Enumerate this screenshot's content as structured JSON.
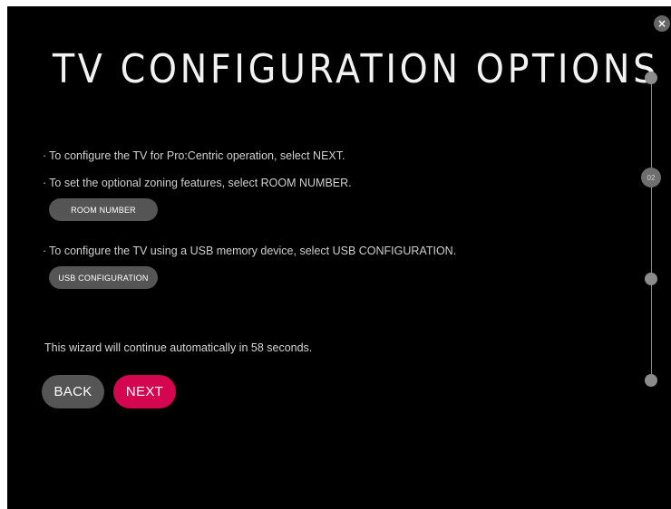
{
  "title": "TV CONFIGURATION OPTIONS",
  "instructions": {
    "next_line": "To configure the TV for Pro:Centric operation, select NEXT.",
    "room_line": "To set the optional zoning features, select ROOM NUMBER.",
    "usb_line": "To configure the TV using a USB memory device, select USB CONFIGURATION.",
    "bullet": "·"
  },
  "buttons": {
    "room_number": "ROOM NUMBER",
    "usb_configuration": "USB CONFIGURATION",
    "back": "BACK",
    "next": "NEXT",
    "close": "×"
  },
  "status_text": "This wizard will continue automatically in 58 seconds.",
  "progress": {
    "current_step_label": "02",
    "current_step": 2,
    "total_steps": 4
  },
  "colors": {
    "background": "#000000",
    "button_gray": "#555555",
    "accent": "#d4064f",
    "progress_gray": "#8c8c8c"
  }
}
